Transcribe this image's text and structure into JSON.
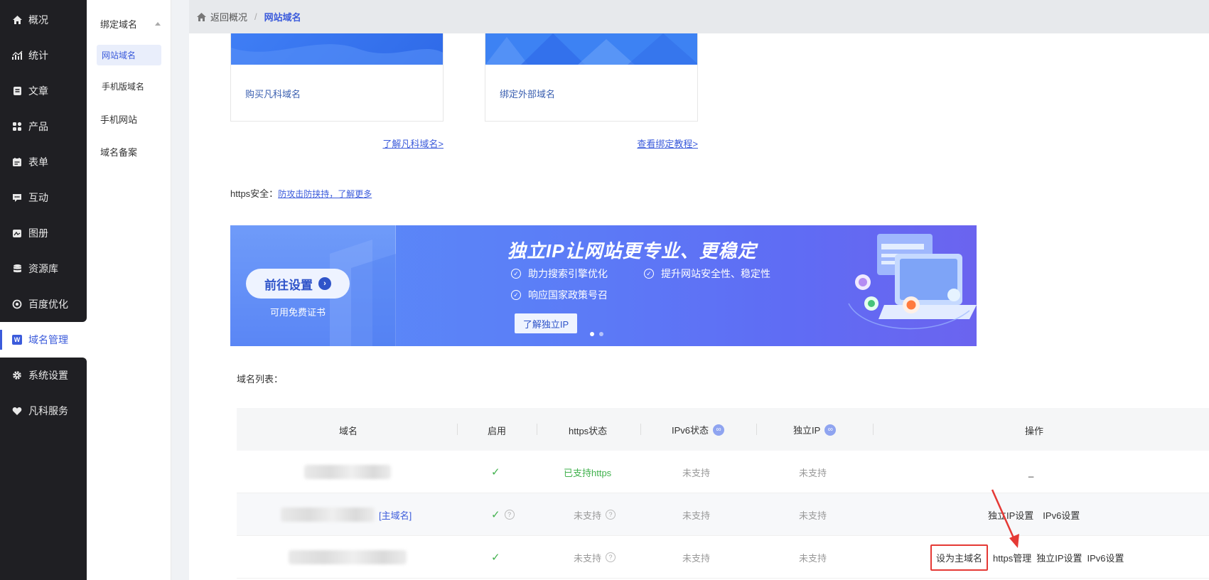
{
  "nav": {
    "items": [
      {
        "label": "概况",
        "icon": "home-icon"
      },
      {
        "label": "统计",
        "icon": "stats-icon"
      },
      {
        "label": "文章",
        "icon": "article-icon"
      },
      {
        "label": "产品",
        "icon": "product-icon"
      },
      {
        "label": "表单",
        "icon": "form-icon"
      },
      {
        "label": "互动",
        "icon": "chat-icon"
      },
      {
        "label": "图册",
        "icon": "gallery-icon"
      },
      {
        "label": "资源库",
        "icon": "database-icon"
      },
      {
        "label": "百度优化",
        "icon": "seo-icon"
      },
      {
        "label": "域名管理",
        "icon": "w-badge-icon",
        "badge": "W"
      },
      {
        "label": "系统设置",
        "icon": "gear-icon"
      },
      {
        "label": "凡科服务",
        "icon": "heart-icon"
      }
    ]
  },
  "subnav": {
    "group_title": "绑定域名",
    "items": [
      "网站域名",
      "手机版域名"
    ],
    "top_items": [
      "手机网站",
      "域名备案"
    ]
  },
  "breadcrumb": {
    "home": "返回概况",
    "separator": "/",
    "current": "网站域名"
  },
  "cards": [
    {
      "label": "购买凡科域名",
      "link": "了解凡科域名>"
    },
    {
      "label": "绑定外部域名",
      "link": "查看绑定教程>"
    }
  ],
  "https": {
    "label": "https安全：",
    "link": "防攻击防挟持，了解更多"
  },
  "banner": {
    "button": "前往设置",
    "subtext": "可用免费证书",
    "title": "独立IP让网站更专业、更稳定",
    "features": [
      "助力搜索引擎优化",
      "提升网站安全性、稳定性",
      "响应国家政策号召"
    ],
    "cta": "了解独立IP"
  },
  "list": {
    "label": "域名列表：",
    "headers": [
      "域名",
      "启用",
      "https状态",
      "IPv6状态",
      "独立IP",
      "操作"
    ],
    "rows": [
      {
        "primary_tag": "",
        "https": "已支持https",
        "ipv6": "未支持",
        "ip": "未支持",
        "ops": [
          "_"
        ]
      },
      {
        "primary_tag": "[主域名]",
        "https": "未支持",
        "ipv6": "未支持",
        "ip": "未支持",
        "ops": [
          "独立IP设置",
          "IPv6设置"
        ]
      },
      {
        "primary_tag": "",
        "https": "未支持",
        "ipv6": "未支持",
        "ip": "未支持",
        "ops": [
          "设为主域名",
          "https管理",
          "独立IP设置",
          "IPv6设置"
        ]
      }
    ]
  },
  "colors": {
    "accent": "#3b5bdb",
    "nav_bg": "#1f1f23",
    "success": "#41b14d",
    "highlight": "#e53935"
  }
}
